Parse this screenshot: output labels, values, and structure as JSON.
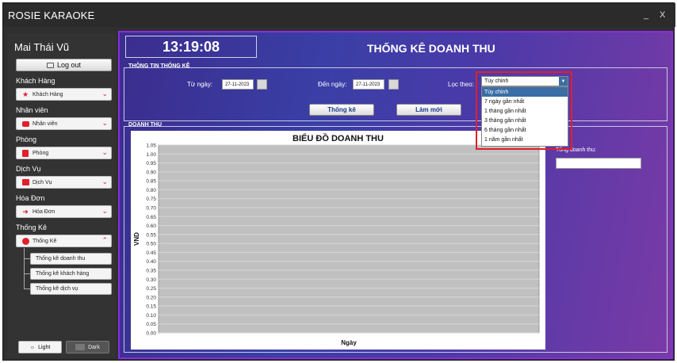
{
  "window": {
    "title": "ROSIE KARAOKE",
    "minimize": "_",
    "close": "X"
  },
  "sidebar": {
    "user_name": "Mai Thái Vũ",
    "logout_label": "Log out",
    "sections": [
      {
        "heading": "Khách Hàng",
        "combo": "Khách Hàng",
        "icon": "star-icon"
      },
      {
        "heading": "Nhân viên",
        "combo": "Nhân viên",
        "icon": "employee-icon"
      },
      {
        "heading": "Phòng",
        "combo": "Phòng",
        "icon": "room-icon"
      },
      {
        "heading": "Dịch Vụ",
        "combo": "Dịch Vụ",
        "icon": "service-icon"
      },
      {
        "heading": "Hóa Đơn",
        "combo": "Hóa Đơn",
        "icon": "invoice-icon"
      },
      {
        "heading": "Thống Kê",
        "combo": "Thống Kê",
        "icon": "pie-icon"
      }
    ],
    "submenu": [
      "Thống kê doanh thu",
      "Thống kê khách hàng",
      "Thống kê dịch vụ"
    ],
    "theme": {
      "light": "Light",
      "dark": "Dark"
    }
  },
  "header": {
    "clock": "13:19:08",
    "title": "THỐNG KÊ DOANH THU"
  },
  "filter": {
    "group_title": "THÔNG TIN THỐNG KÊ",
    "from_label": "Từ ngày:",
    "from_value": "27-11-2023",
    "to_label": "Đến ngày:",
    "to_value": "27-11-2023",
    "filter_label": "Lọc theo:",
    "filter_value": "Tùy chỉnh",
    "options": [
      "Tùy chỉnh",
      "7 ngày gần nhất",
      "1 tháng gần nhất",
      "3 tháng gần nhất",
      "6 tháng gần nhất",
      "1 năm gần nhất"
    ],
    "stats_button": "Thống kê",
    "refresh_button": "Làm mới"
  },
  "revenue": {
    "group_title": "DOANH THU",
    "total_label": "Tổng doanh thu:",
    "total_value": ""
  },
  "chart_data": {
    "type": "line",
    "title": "BIỂU ĐỒ DOANH THU",
    "xlabel": "Ngày",
    "ylabel": "VND",
    "ylim": [
      0,
      1.05
    ],
    "yticks": [
      "0.00",
      "0.05",
      "0.10",
      "0.15",
      "0.20",
      "0.25",
      "0.30",
      "0.35",
      "0.40",
      "0.45",
      "0.50",
      "0.55",
      "0.60",
      "0.65",
      "0.70",
      "0.75",
      "0.80",
      "0.85",
      "0.90",
      "0.95",
      "1.00",
      "1.05"
    ],
    "categories": [],
    "series": [],
    "plot_background": "#c0c0c0",
    "grid": true
  }
}
